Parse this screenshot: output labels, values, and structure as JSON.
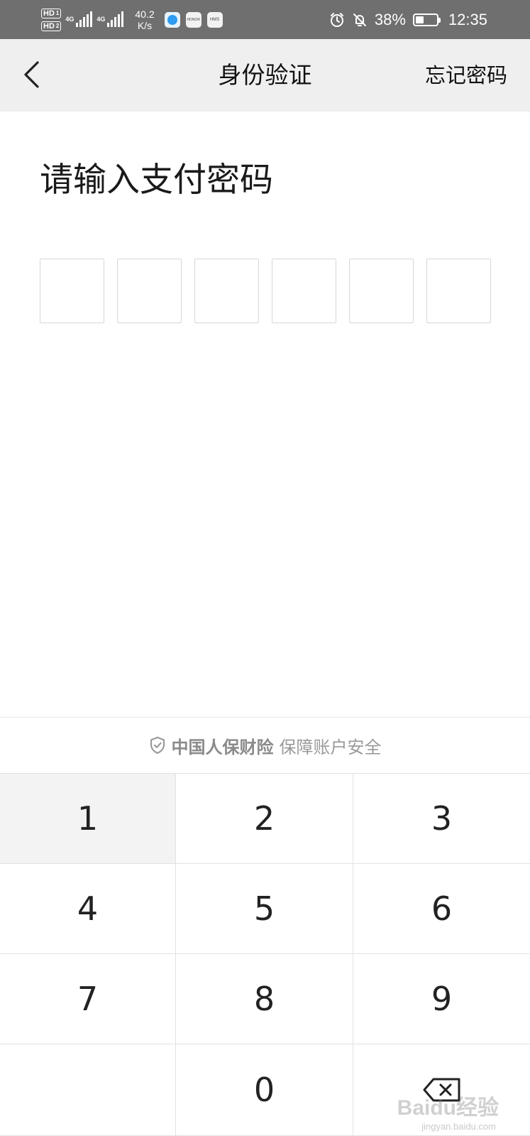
{
  "status_bar": {
    "hd1": "HD",
    "hd1_num": "1",
    "hd2": "HD",
    "hd2_num": "2",
    "net1": "4G",
    "net2": "4G",
    "speed_value": "40.2",
    "speed_unit": "K/s",
    "app_icon_2": "HONOR",
    "app_icon_3": "HMS",
    "battery_percent": "38%",
    "battery_level": 0.38,
    "time": "12:35"
  },
  "nav": {
    "title": "身份验证",
    "forgot_label": "忘记密码",
    "back_icon": "chevron-left-icon"
  },
  "main": {
    "prompt": "请输入支付密码",
    "pin_length": 6
  },
  "security": {
    "icon": "shield-check-icon",
    "brand": "中国人保财险",
    "text": "保障账户安全"
  },
  "keypad": {
    "keys": [
      "1",
      "2",
      "3",
      "4",
      "5",
      "6",
      "7",
      "8",
      "9",
      "",
      "0",
      "backspace"
    ]
  },
  "watermark": {
    "text": "Baidu经验",
    "sub": "jingyan.baidu.com"
  },
  "colors": {
    "status_bar_bg": "#6f6f6f",
    "nav_bg": "#efefef",
    "divider": "#e2e2e2",
    "security_text": "#9a9a9a"
  }
}
